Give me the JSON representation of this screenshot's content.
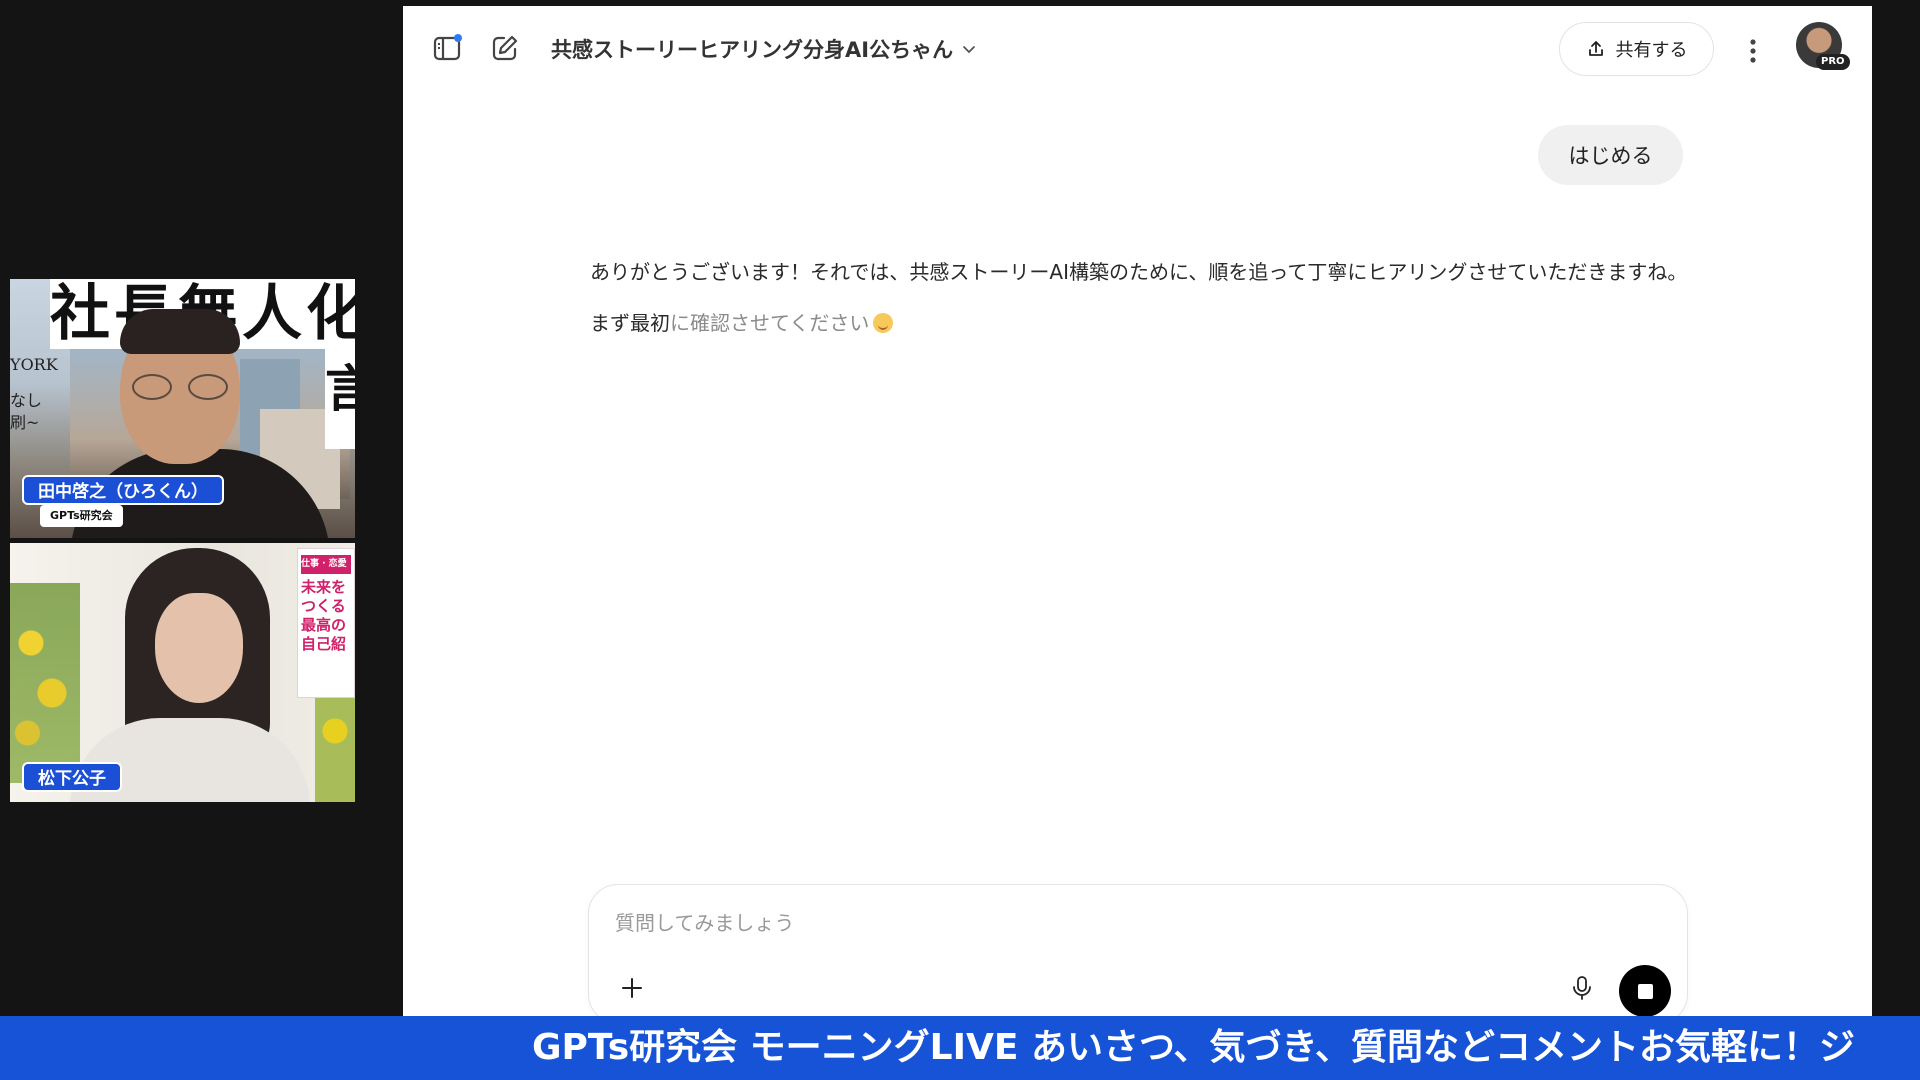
{
  "participants": [
    {
      "name": "田中啓之（ひろくん）",
      "org": "GPTs研究会",
      "background_poster": {
        "headline": "社長無人化",
        "side_text_1": "YORK",
        "side_text_2": "なし",
        "side_text_3": "刷~"
      }
    },
    {
      "name": "松下公子",
      "background_book": {
        "tagline": "仕事 · 恋愛",
        "title_lines": [
          "未来を",
          "つくる",
          "最高の",
          "自己紹"
        ]
      }
    }
  ],
  "chat": {
    "gpt_title": "共感ストーリーヒアリング分身AI公ちゃん",
    "share_label": "共有する",
    "pro_badge": "PRO",
    "user_message": "はじめる",
    "assistant_paragraph_1": "ありがとうございます！それでは、共感ストーリーAI構築のために、順を追って丁寧にヒアリングさせていただきますね。",
    "assistant_paragraph_2_start": "まず最初",
    "assistant_paragraph_2_streaming": "に確認させてください",
    "composer_placeholder": "質問してみましょう",
    "icons": [
      "sidebar-icon",
      "compose-icon",
      "chevron-down-icon",
      "share-icon",
      "more-vertical-icon",
      "plus-icon",
      "microphone-icon",
      "stop-icon"
    ]
  },
  "ticker": {
    "text": "GPTs研究会 モーニングLIVE あいさつ、気づき、質問などコメントお気軽に！ジ"
  },
  "colors": {
    "accent_blue": "#1653d6",
    "name_badge": "#1a4fd6",
    "chat_background": "#ffffff",
    "stage_background": "#141414"
  }
}
